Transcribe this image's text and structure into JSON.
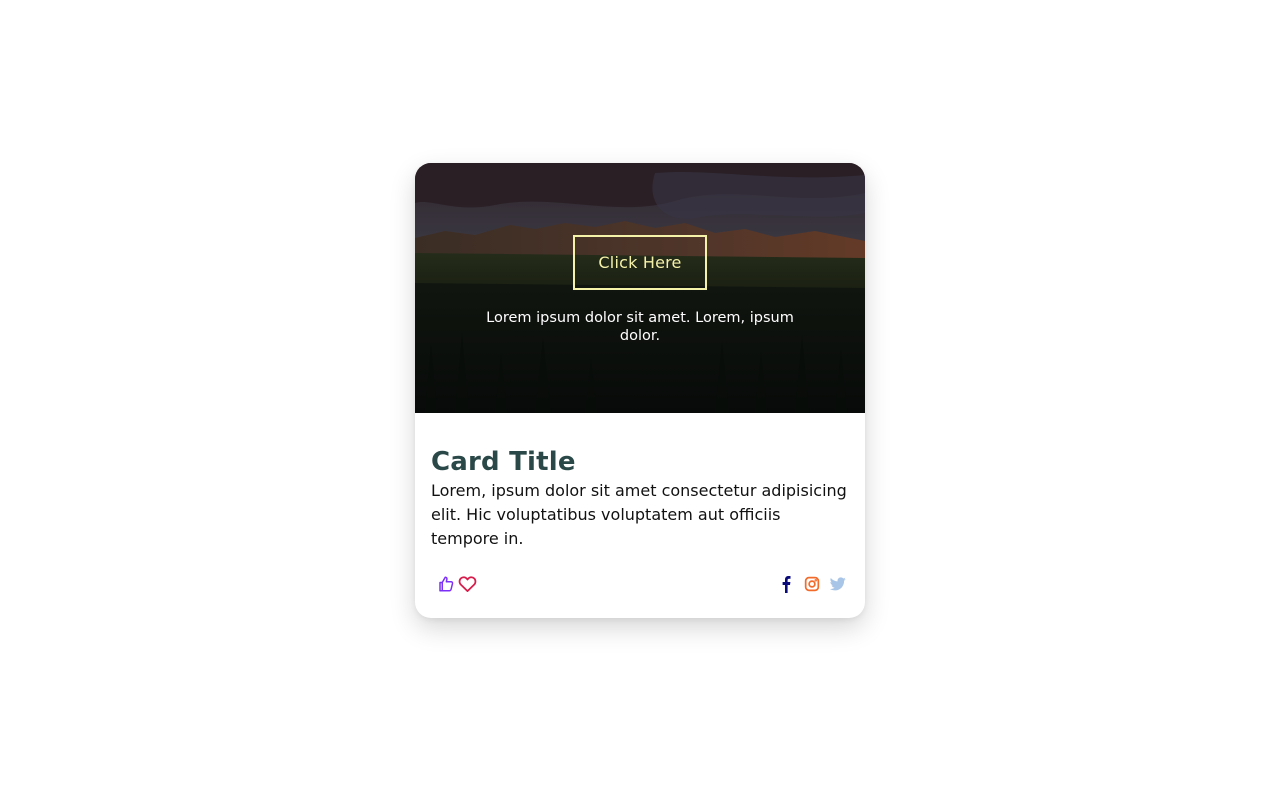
{
  "card": {
    "image": {
      "button_label": "Click Here",
      "caption": "Lorem ipsum dolor sit amet. Lorem, ipsum dolor."
    },
    "title": "Card Title",
    "text": "Lorem, ipsum dolor sit amet consectetur adipisicing elit. Hic voluptatibus voluptatem aut officiis tempore in.",
    "actions": [
      {
        "icon": "thumbs-up-icon",
        "color": "#7b2ff7"
      },
      {
        "icon": "heart-icon",
        "color": "#d81b4a"
      }
    ],
    "social": [
      {
        "icon": "facebook-icon",
        "color": "#0a0a7a"
      },
      {
        "icon": "instagram-icon",
        "color": "#f36b2b"
      },
      {
        "icon": "twitter-icon",
        "color": "#a8c4e6"
      }
    ]
  },
  "colors": {
    "title": "#2a4848",
    "button_border": "#f4f1a8",
    "page_background": "#ffffff"
  }
}
